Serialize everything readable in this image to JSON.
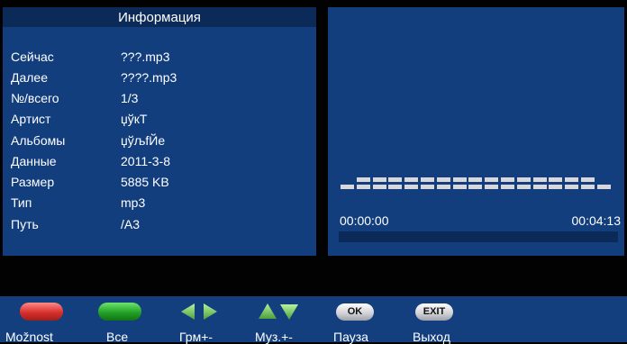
{
  "info": {
    "title": "Информация",
    "rows": [
      {
        "key": "Сейчас",
        "value": "???.mp3"
      },
      {
        "key": "Далее",
        "value": "????.mp3"
      },
      {
        "key": "№/всего",
        "value": "1/3"
      },
      {
        "key": "Артист",
        "value": "џўкТ"
      },
      {
        "key": "Альбомы",
        "value": "џўљfЙе"
      },
      {
        "key": "Данные",
        "value": "2011-3-8"
      },
      {
        "key": "Размер",
        "value": "5885 KB"
      },
      {
        "key": "Тип",
        "value": "mp3"
      },
      {
        "key": "Путь",
        "value": "/A3"
      }
    ]
  },
  "player": {
    "elapsed": "00:00:00",
    "duration": "00:04:13",
    "progress": 0,
    "equalizer_levels": [
      1,
      2,
      2,
      2,
      2,
      2,
      2,
      2,
      2,
      2,
      2,
      2,
      2,
      2,
      2,
      2,
      1
    ]
  },
  "controls": [
    {
      "label": "Možnost",
      "icon": "red-button-icon"
    },
    {
      "label": "Все",
      "icon": "green-button-icon"
    },
    {
      "label": "Грм+-",
      "icon": "left-right-arrows-icon"
    },
    {
      "label": "Муз.+-",
      "icon": "up-down-arrows-icon"
    },
    {
      "label": "Пауза",
      "icon": "ok-key-icon",
      "key_text": "OK"
    },
    {
      "label": "Выход",
      "icon": "exit-key-icon",
      "key_text": "EXIT"
    }
  ],
  "colors": {
    "panel": "#123e7d",
    "panel_dark": "#0c2a57",
    "bar": "#133f7f",
    "eq": "#d8d8dc"
  }
}
